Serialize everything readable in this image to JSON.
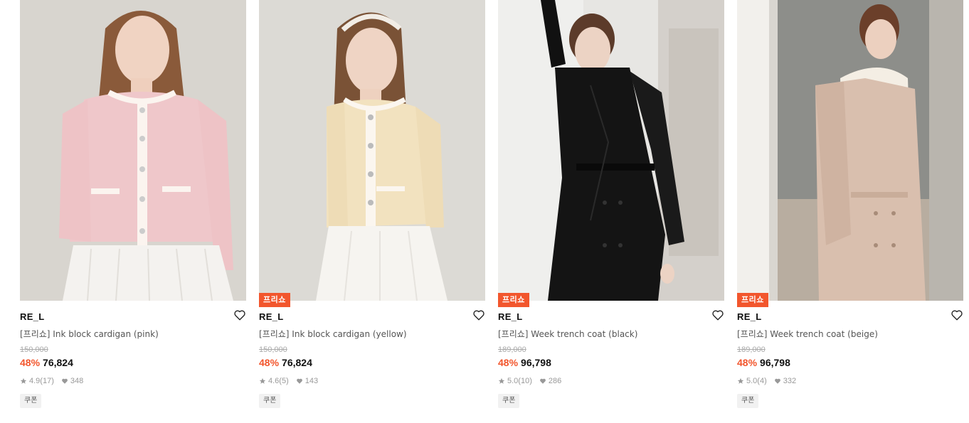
{
  "products": [
    {
      "brand": "RE_L",
      "title": "[프리쇼] Ink block cardigan (pink)",
      "original_price": "150,000",
      "discount": "48%",
      "price": "76,824",
      "rating": "4.9",
      "reviews": "(17)",
      "likes": "348",
      "badge": "",
      "coupon": "쿠폰"
    },
    {
      "brand": "RE_L",
      "title": "[프리쇼] Ink block cardigan (yellow)",
      "original_price": "150,000",
      "discount": "48%",
      "price": "76,824",
      "rating": "4.6",
      "reviews": "(5)",
      "likes": "143",
      "badge": "프리쇼",
      "coupon": "쿠폰"
    },
    {
      "brand": "RE_L",
      "title": "[프리쇼] Week trench coat (black)",
      "original_price": "189,000",
      "discount": "48%",
      "price": "96,798",
      "rating": "5.0",
      "reviews": "(10)",
      "likes": "286",
      "badge": "프리쇼",
      "coupon": "쿠폰"
    },
    {
      "brand": "RE_L",
      "title": "[프리쇼] Week trench coat (beige)",
      "original_price": "189,000",
      "discount": "48%",
      "price": "96,798",
      "rating": "5.0",
      "reviews": "(4)",
      "likes": "332",
      "badge": "프리쇼",
      "coupon": "쿠폰"
    }
  ],
  "colors": {
    "accent": "#f2562d",
    "muted": "#999999"
  },
  "icons": {
    "wishlist": "heart-outline-icon",
    "rating": "star-icon",
    "likes": "heart-filled-icon"
  }
}
